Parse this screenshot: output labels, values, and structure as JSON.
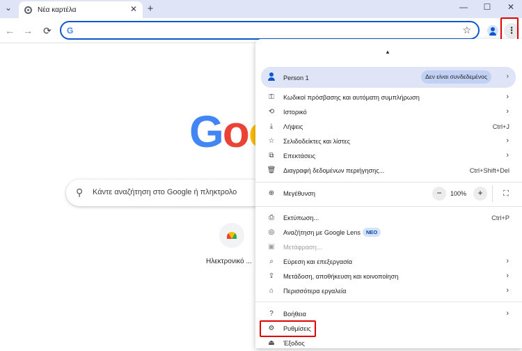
{
  "tab": {
    "title": "Νέα καρτέλα",
    "close": "✕",
    "new_tab": "+",
    "list": "⌄"
  },
  "window": {
    "minimize": "—",
    "maximize": "☐",
    "close": "✕"
  },
  "toolbar": {
    "back": "←",
    "forward": "→",
    "reload": "⟳",
    "address_value": "",
    "g_icon": "G",
    "star": "☆",
    "menu": "⋮"
  },
  "page": {
    "logo_letters": [
      {
        "ch": "G",
        "color": "#4285f4"
      },
      {
        "ch": "o",
        "color": "#ea4335"
      },
      {
        "ch": "o",
        "color": "#fbbc05"
      }
    ],
    "search_placeholder": "Κάντε αναζήτηση στο Google ή πληκτρολο",
    "shortcut_label": "Ηλεκτρονικό ..."
  },
  "menu": {
    "caret": "▲",
    "profile": {
      "name": "Person 1",
      "status": "Δεν είναι συνδεδεμένος",
      "chevron": "›"
    },
    "items": [
      {
        "id": "passwords",
        "icon": "key-icon",
        "glyph": "⚿",
        "label": "Κωδικοί πρόσβασης και αυτόματη συμπλήρωση",
        "shortcut": "",
        "chevron": "›"
      },
      {
        "id": "history",
        "icon": "history-icon",
        "glyph": "⟲",
        "label": "Ιστορικό",
        "shortcut": "",
        "chevron": "›"
      },
      {
        "id": "downloads",
        "icon": "download-icon",
        "glyph": "⤓",
        "label": "Λήψεις",
        "shortcut": "Ctrl+J",
        "chevron": ""
      },
      {
        "id": "bookmarks",
        "icon": "star-icon",
        "glyph": "☆",
        "label": "Σελιδοδείκτες και λίστες",
        "shortcut": "",
        "chevron": "›"
      },
      {
        "id": "extensions",
        "icon": "puzzle-icon",
        "glyph": "⧉",
        "label": "Επεκτάσεις",
        "shortcut": "",
        "chevron": "›"
      },
      {
        "id": "clear-data",
        "icon": "trash-icon",
        "glyph": "🗑",
        "label": "Διαγραφή δεδομένων περιήγησης...",
        "shortcut": "Ctrl+Shift+Del",
        "chevron": ""
      }
    ],
    "zoom": {
      "icon": "zoom-icon",
      "glyph": "⊕",
      "label": "Μεγέθυνση",
      "minus": "−",
      "value": "100%",
      "plus": "+",
      "fullscreen": "⛶"
    },
    "items2": [
      {
        "id": "print",
        "icon": "print-icon",
        "glyph": "⎙",
        "label": "Εκτύπωση...",
        "shortcut": "Ctrl+P",
        "chevron": "",
        "disabled": false
      },
      {
        "id": "google-lens",
        "icon": "lens-icon",
        "glyph": "◎",
        "label": "Αναζήτηση με Google Lens",
        "shortcut": "",
        "chevron": "",
        "disabled": false
      },
      {
        "id": "translate",
        "icon": "translate-icon",
        "glyph": "▣",
        "label": "Μετάφραση...",
        "shortcut": "",
        "chevron": "",
        "disabled": true
      },
      {
        "id": "find-edit",
        "icon": "find-icon",
        "glyph": "⌕",
        "label": "Εύρεση και επεξεργασία",
        "shortcut": "",
        "chevron": "›",
        "disabled": false
      },
      {
        "id": "cast-save-share",
        "icon": "share-icon",
        "glyph": "⇪",
        "label": "Μετάδοση, αποθήκευση και κοινοποίηση",
        "shortcut": "",
        "chevron": "›",
        "disabled": false
      },
      {
        "id": "more-tools",
        "icon": "toolbox-icon",
        "glyph": "⌂",
        "label": "Περισσότερα εργαλεία",
        "shortcut": "",
        "chevron": "›",
        "disabled": false
      }
    ],
    "new_badge": "ΝΕΟ",
    "items3": [
      {
        "id": "help",
        "icon": "help-icon",
        "glyph": "?",
        "label": "Βοήθεια",
        "chevron": "›"
      },
      {
        "id": "settings",
        "icon": "gear-icon",
        "glyph": "⚙",
        "label": "Ρυθμίσεις",
        "chevron": ""
      },
      {
        "id": "exit",
        "icon": "exit-icon",
        "glyph": "⏏",
        "label": "Έξοδος",
        "chevron": ""
      }
    ]
  }
}
